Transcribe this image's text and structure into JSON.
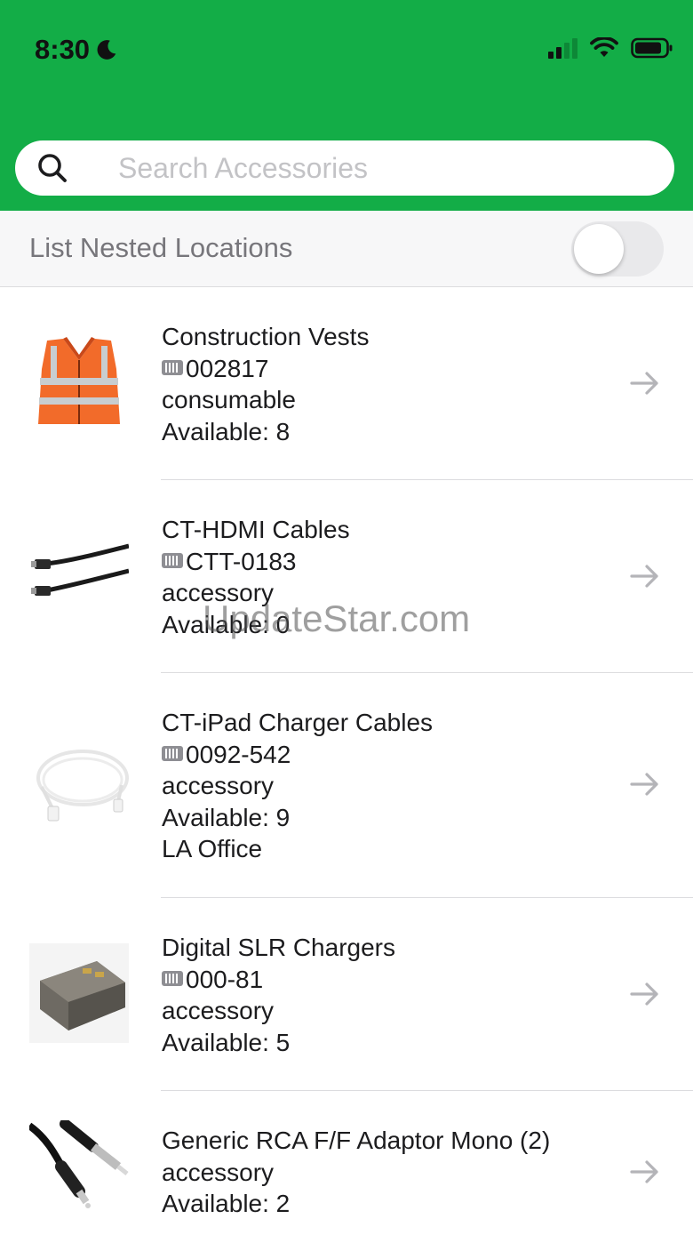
{
  "status_bar": {
    "time": "8:30"
  },
  "search": {
    "placeholder": "Search Accessories",
    "value": ""
  },
  "nested_locations": {
    "label": "List Nested Locations",
    "enabled": false
  },
  "items": [
    {
      "name": "Construction Vests",
      "code": "002817",
      "type": "consumable",
      "available": "Available: 8",
      "location": "",
      "image": "orange-safety-vest"
    },
    {
      "name": "CT-HDMI Cables",
      "code": "CTT-0183",
      "type": "accessory",
      "available": "Available: 0",
      "location": "",
      "image": "hdmi-cable"
    },
    {
      "name": "CT-iPad Charger Cables",
      "code": "0092-542",
      "type": "accessory",
      "available": "Available: 9",
      "location": "LA Office",
      "image": "white-usb-cable"
    },
    {
      "name": "Digital SLR Chargers",
      "code": "000-81",
      "type": "accessory",
      "available": "Available: 5",
      "location": "",
      "image": "camera-battery"
    },
    {
      "name": "Generic RCA F/F Adaptor Mono (2)",
      "type": "accessory",
      "available": "Available: 2",
      "image": "rca-audio-cable"
    }
  ],
  "watermark": "UpdateStar.com",
  "colors": {
    "header": "#13ad47",
    "divider": "#dcdcdf",
    "arrow": "#b4b4b8"
  }
}
